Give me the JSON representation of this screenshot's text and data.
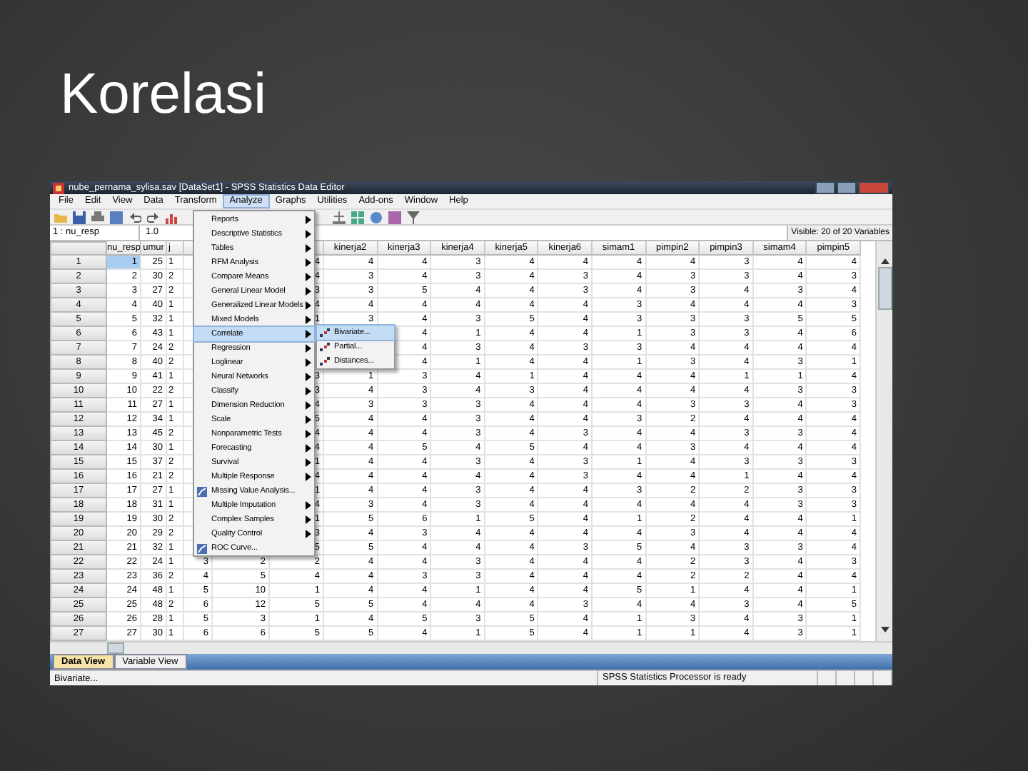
{
  "slide": {
    "title": "Korelasi"
  },
  "window": {
    "title": "nube_pernama_sylisa.sav [DataSet1] - SPSS Statistics Data Editor"
  },
  "menu_bar": [
    {
      "label": "File",
      "selected": false
    },
    {
      "label": "Edit",
      "selected": false
    },
    {
      "label": "View",
      "selected": false
    },
    {
      "label": "Data",
      "selected": false
    },
    {
      "label": "Transform",
      "selected": false
    },
    {
      "label": "Analyze",
      "selected": true
    },
    {
      "label": "Graphs",
      "selected": false
    },
    {
      "label": "Utilities",
      "selected": false
    },
    {
      "label": "Add-ons",
      "selected": false
    },
    {
      "label": "Window",
      "selected": false
    },
    {
      "label": "Help",
      "selected": false
    }
  ],
  "cell_editor": {
    "cell": "1 : nu_resp",
    "value": "1.0",
    "visible": "Visible: 20 of 20 Variables"
  },
  "table": {
    "columns": [
      "nu_resp",
      "umur",
      "j",
      null,
      null,
      null,
      "kinerja2",
      "kinerja3",
      "kinerja4",
      "kinerja5",
      "kinerja6",
      "simam1",
      "pimpin2",
      "pimpin3",
      "simam4",
      "pimpin5"
    ],
    "rows": [
      {
        "label": "1",
        "current": true,
        "cells": [
          "1",
          "25",
          "1",
          null,
          null,
          "4",
          "4",
          "4",
          "3",
          "4",
          "4",
          "4",
          "4",
          "3",
          "4",
          "4"
        ]
      },
      {
        "label": "2",
        "current": false,
        "cells": [
          "2",
          "30",
          "2",
          null,
          null,
          "4",
          "3",
          "4",
          "3",
          "4",
          "3",
          "4",
          "3",
          "3",
          "4",
          "3"
        ]
      },
      {
        "label": "3",
        "current": false,
        "cells": [
          "3",
          "27",
          "2",
          null,
          null,
          "3",
          "3",
          "5",
          "4",
          "4",
          "3",
          "4",
          "3",
          "4",
          "3",
          "4"
        ]
      },
      {
        "label": "4",
        "current": false,
        "cells": [
          "4",
          "40",
          "1",
          null,
          null,
          "4",
          "4",
          "4",
          "4",
          "4",
          "4",
          "3",
          "4",
          "4",
          "4",
          "3"
        ]
      },
      {
        "label": "5",
        "current": false,
        "cells": [
          "5",
          "32",
          "1",
          null,
          null,
          "1",
          "3",
          "4",
          "3",
          "5",
          "4",
          "3",
          "3",
          "3",
          "5",
          "5"
        ]
      },
      {
        "label": "6",
        "current": false,
        "cells": [
          "6",
          "43",
          "1",
          null,
          null,
          null,
          null,
          "4",
          "1",
          "4",
          "4",
          "1",
          "3",
          "3",
          "4",
          "6"
        ]
      },
      {
        "label": "7",
        "current": false,
        "cells": [
          "7",
          "24",
          "2",
          null,
          null,
          null,
          null,
          "4",
          "3",
          "4",
          "3",
          "3",
          "4",
          "4",
          "4",
          "4"
        ]
      },
      {
        "label": "8",
        "current": false,
        "cells": [
          "8",
          "40",
          "2",
          null,
          null,
          null,
          null,
          "4",
          "1",
          "4",
          "4",
          "1",
          "3",
          "4",
          "3",
          "1"
        ]
      },
      {
        "label": "9",
        "current": false,
        "cells": [
          "9",
          "41",
          "1",
          null,
          null,
          "3",
          "1",
          "3",
          "4",
          "1",
          "4",
          "4",
          "4",
          "1",
          "1",
          "4"
        ]
      },
      {
        "label": "10",
        "current": false,
        "cells": [
          "10",
          "22",
          "2",
          null,
          null,
          "3",
          "4",
          "3",
          "4",
          "3",
          "4",
          "4",
          "4",
          "4",
          "3",
          "3"
        ]
      },
      {
        "label": "11",
        "current": false,
        "cells": [
          "11",
          "27",
          "1",
          null,
          null,
          "4",
          "3",
          "3",
          "3",
          "4",
          "4",
          "4",
          "3",
          "3",
          "4",
          "3"
        ]
      },
      {
        "label": "12",
        "current": false,
        "cells": [
          "12",
          "34",
          "1",
          null,
          null,
          "5",
          "4",
          "4",
          "3",
          "4",
          "4",
          "3",
          "2",
          "4",
          "4",
          "4"
        ]
      },
      {
        "label": "13",
        "current": false,
        "cells": [
          "13",
          "45",
          "2",
          null,
          null,
          "4",
          "4",
          "4",
          "3",
          "4",
          "3",
          "4",
          "4",
          "3",
          "3",
          "4"
        ]
      },
      {
        "label": "14",
        "current": false,
        "cells": [
          "14",
          "30",
          "1",
          null,
          null,
          "4",
          "4",
          "5",
          "4",
          "5",
          "4",
          "4",
          "3",
          "4",
          "4",
          "4"
        ]
      },
      {
        "label": "15",
        "current": false,
        "cells": [
          "15",
          "37",
          "2",
          null,
          null,
          "1",
          "4",
          "4",
          "3",
          "4",
          "3",
          "1",
          "4",
          "3",
          "3",
          "3"
        ]
      },
      {
        "label": "16",
        "current": false,
        "cells": [
          "16",
          "21",
          "2",
          null,
          null,
          "4",
          "4",
          "4",
          "4",
          "4",
          "3",
          "4",
          "4",
          "1",
          "4",
          "4"
        ]
      },
      {
        "label": "17",
        "current": false,
        "cells": [
          "17",
          "27",
          "1",
          null,
          null,
          "1",
          "4",
          "4",
          "3",
          "4",
          "4",
          "3",
          "2",
          "2",
          "3",
          "3"
        ]
      },
      {
        "label": "18",
        "current": false,
        "cells": [
          "18",
          "31",
          "1",
          null,
          null,
          "4",
          "3",
          "4",
          "3",
          "4",
          "4",
          "4",
          "4",
          "4",
          "3",
          "3"
        ]
      },
      {
        "label": "19",
        "current": false,
        "cells": [
          "19",
          "30",
          "2",
          null,
          null,
          "1",
          "5",
          "6",
          "1",
          "5",
          "4",
          "1",
          "2",
          "4",
          "4",
          "1"
        ]
      },
      {
        "label": "20",
        "current": false,
        "cells": [
          "20",
          "29",
          "2",
          null,
          null,
          "3",
          "4",
          "3",
          "4",
          "4",
          "4",
          "4",
          "3",
          "4",
          "4",
          "4"
        ]
      },
      {
        "label": "21",
        "current": false,
        "cells": [
          "21",
          "32",
          "1",
          null,
          null,
          "5",
          "5",
          "4",
          "4",
          "4",
          "3",
          "5",
          "4",
          "3",
          "3",
          "4"
        ]
      },
      {
        "label": "22",
        "current": false,
        "cells": [
          "22",
          "24",
          "1",
          "3",
          "2",
          "2",
          "4",
          "4",
          "3",
          "4",
          "4",
          "4",
          "2",
          "3",
          "4",
          "3"
        ]
      },
      {
        "label": "23",
        "current": false,
        "cells": [
          "23",
          "36",
          "2",
          "4",
          "5",
          "4",
          "4",
          "3",
          "3",
          "4",
          "4",
          "4",
          "2",
          "2",
          "4",
          "4"
        ]
      },
      {
        "label": "24",
        "current": false,
        "cells": [
          "24",
          "48",
          "1",
          "5",
          "10",
          "1",
          "4",
          "4",
          "1",
          "4",
          "4",
          "5",
          "1",
          "4",
          "4",
          "1"
        ]
      },
      {
        "label": "25",
        "current": false,
        "cells": [
          "25",
          "48",
          "2",
          "6",
          "12",
          "5",
          "5",
          "4",
          "4",
          "4",
          "3",
          "4",
          "4",
          "3",
          "4",
          "5"
        ]
      },
      {
        "label": "26",
        "current": false,
        "cells": [
          "26",
          "28",
          "1",
          "5",
          "3",
          "1",
          "4",
          "5",
          "3",
          "5",
          "4",
          "1",
          "3",
          "4",
          "3",
          "1"
        ]
      },
      {
        "label": "27",
        "current": false,
        "cells": [
          "27",
          "30",
          "1",
          "6",
          "6",
          "5",
          "5",
          "4",
          "1",
          "5",
          "4",
          "1",
          "1",
          "4",
          "3",
          "1"
        ]
      }
    ]
  },
  "analyze_menu": {
    "items": [
      {
        "label": "Reports",
        "kind": "submenu",
        "selected": false
      },
      {
        "label": "Descriptive Statistics",
        "kind": "submenu",
        "selected": false
      },
      {
        "label": "Tables",
        "kind": "submenu",
        "selected": false
      },
      {
        "label": "RFM Analysis",
        "kind": "submenu",
        "selected": false
      },
      {
        "label": "Compare Means",
        "kind": "submenu",
        "selected": false
      },
      {
        "label": "General Linear Model",
        "kind": "submenu",
        "selected": false
      },
      {
        "label": "Generalized Linear Models",
        "kind": "submenu",
        "selected": false
      },
      {
        "label": "Mixed Models",
        "kind": "submenu",
        "selected": false
      },
      {
        "label": "Correlate",
        "kind": "submenu",
        "selected": true
      },
      {
        "label": "Regression",
        "kind": "submenu",
        "selected": false
      },
      {
        "label": "Loglinear",
        "kind": "submenu",
        "selected": false
      },
      {
        "label": "Neural Networks",
        "kind": "submenu",
        "selected": false
      },
      {
        "label": "Classify",
        "kind": "submenu",
        "selected": false
      },
      {
        "label": "Dimension Reduction",
        "kind": "submenu",
        "selected": false
      },
      {
        "label": "Scale",
        "kind": "submenu",
        "selected": false
      },
      {
        "label": "Nonparametric Tests",
        "kind": "submenu",
        "selected": false
      },
      {
        "label": "Forecasting",
        "kind": "submenu",
        "selected": false
      },
      {
        "label": "Survival",
        "kind": "submenu",
        "selected": false
      },
      {
        "label": "Multiple Response",
        "kind": "submenu",
        "selected": false
      },
      {
        "label": "Missing Value Analysis...",
        "kind": "action",
        "selected": false
      },
      {
        "label": "Multiple Imputation",
        "kind": "submenu",
        "selected": false
      },
      {
        "label": "Complex Samples",
        "kind": "submenu",
        "selected": false
      },
      {
        "label": "Quality Control",
        "kind": "submenu",
        "selected": false
      },
      {
        "label": "ROC Curve...",
        "kind": "action",
        "selected": false
      }
    ]
  },
  "correlate_submenu": {
    "items": [
      {
        "label": "Bivariate...",
        "selected": true
      },
      {
        "label": "Partial...",
        "selected": false
      },
      {
        "label": "Distances...",
        "selected": false
      }
    ]
  },
  "tabs": [
    {
      "label": "Data View",
      "selected": true
    },
    {
      "label": "Variable View",
      "selected": false
    }
  ],
  "status_bar": {
    "message": "Bivariate...",
    "processor": "SPSS Statistics Processor is ready"
  }
}
